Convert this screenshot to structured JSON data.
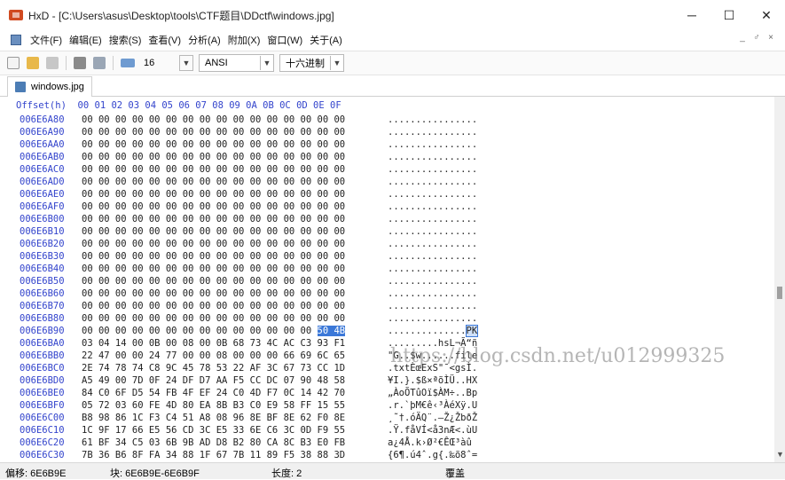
{
  "window": {
    "title": "HxD - [C:\\Users\\asus\\Desktop\\tools\\CTF题目\\DDctf\\windows.jpg]",
    "minimize": "─",
    "maximize": "☐",
    "close": "✕"
  },
  "menu": {
    "items": [
      "文件(F)",
      "编辑(E)",
      "搜索(S)",
      "查看(V)",
      "分析(A)",
      "附加(X)",
      "窗口(W)",
      "关于(A)"
    ],
    "mdi": [
      "_",
      "♂",
      "×"
    ]
  },
  "toolbar": {
    "bytes_per_row": "16",
    "charset": "ANSI",
    "offset_base": "十六进制"
  },
  "tab": {
    "label": "windows.jpg"
  },
  "editor": {
    "header": "Offset(h)  00 01 02 03 04 05 06 07 08 09 0A 0B 0C 0D 0E 0F",
    "rows": [
      {
        "offset": "006E6A80",
        "hex": "00 00 00 00 00 00 00 00 00 00 00 00 00 00 00 00",
        "ascii": "................"
      },
      {
        "offset": "006E6A90",
        "hex": "00 00 00 00 00 00 00 00 00 00 00 00 00 00 00 00",
        "ascii": "................"
      },
      {
        "offset": "006E6AA0",
        "hex": "00 00 00 00 00 00 00 00 00 00 00 00 00 00 00 00",
        "ascii": "................"
      },
      {
        "offset": "006E6AB0",
        "hex": "00 00 00 00 00 00 00 00 00 00 00 00 00 00 00 00",
        "ascii": "................"
      },
      {
        "offset": "006E6AC0",
        "hex": "00 00 00 00 00 00 00 00 00 00 00 00 00 00 00 00",
        "ascii": "................"
      },
      {
        "offset": "006E6AD0",
        "hex": "00 00 00 00 00 00 00 00 00 00 00 00 00 00 00 00",
        "ascii": "................"
      },
      {
        "offset": "006E6AE0",
        "hex": "00 00 00 00 00 00 00 00 00 00 00 00 00 00 00 00",
        "ascii": "................"
      },
      {
        "offset": "006E6AF0",
        "hex": "00 00 00 00 00 00 00 00 00 00 00 00 00 00 00 00",
        "ascii": "................"
      },
      {
        "offset": "006E6B00",
        "hex": "00 00 00 00 00 00 00 00 00 00 00 00 00 00 00 00",
        "ascii": "................"
      },
      {
        "offset": "006E6B10",
        "hex": "00 00 00 00 00 00 00 00 00 00 00 00 00 00 00 00",
        "ascii": "................"
      },
      {
        "offset": "006E6B20",
        "hex": "00 00 00 00 00 00 00 00 00 00 00 00 00 00 00 00",
        "ascii": "................"
      },
      {
        "offset": "006E6B30",
        "hex": "00 00 00 00 00 00 00 00 00 00 00 00 00 00 00 00",
        "ascii": "................"
      },
      {
        "offset": "006E6B40",
        "hex": "00 00 00 00 00 00 00 00 00 00 00 00 00 00 00 00",
        "ascii": "................"
      },
      {
        "offset": "006E6B50",
        "hex": "00 00 00 00 00 00 00 00 00 00 00 00 00 00 00 00",
        "ascii": "................"
      },
      {
        "offset": "006E6B60",
        "hex": "00 00 00 00 00 00 00 00 00 00 00 00 00 00 00 00",
        "ascii": "................"
      },
      {
        "offset": "006E6B70",
        "hex": "00 00 00 00 00 00 00 00 00 00 00 00 00 00 00 00",
        "ascii": "................"
      },
      {
        "offset": "006E6B80",
        "hex": "00 00 00 00 00 00 00 00 00 00 00 00 00 00 00 00",
        "ascii": "................"
      },
      {
        "offset": "006E6B90",
        "hex": "00 00 00 00 00 00 00 00 00 00 00 00 00 00",
        "sel_hex": "50 4B",
        "ascii": "..............",
        "sel_ascii": "PK"
      },
      {
        "offset": "006E6BA0",
        "hex": "03 04 14 00 0B 00 08 00 0B 68 73 4C AC C3 93 F1",
        "ascii": ".........hsL¬Ã“ñ"
      },
      {
        "offset": "006E6BB0",
        "hex": "22 47 00 00 24 77 00 00 08 00 00 00 66 69 6C 65",
        "ascii": "\"G..$w......file"
      },
      {
        "offset": "006E6BC0",
        "hex": "2E 74 78 74 C8 9C 45 78 53 22 AF 3C 67 73 CC 1D",
        ".ascii": "",
        "ascii": ".txtÈœExS\"¯<gsÌ."
      },
      {
        "offset": "006E6BD0",
        "hex": "A5 49 00 7D 0F 24 DF D7 AA F5 CC DC 07 90 48 58",
        "ascii": "¥I.}.$ß×ªõÌÜ..HX"
      },
      {
        "offset": "006E6BE0",
        "hex": "84 C0 6F D5 54 FB 4F EF 24 C0 4D F7 0C 14 42 70",
        "ascii": "„ÀoÕTûOï$ÀM÷..Bp"
      },
      {
        "offset": "006E6BF0",
        "hex": "05 72 03 60 FE 4D 80 EA 8B B3 C0 E9 58 FF 15 55",
        "ascii": ".r.`þM€ê‹³ÀéXÿ.U"
      },
      {
        "offset": "006E6C00",
        "hex": "B8 98 86 1C F3 C4 51 A8 08 96 8E BF 8E 62 F0 8E",
        "ascii": "¸˜†.óÄQ¨.–Ž¿ŽbðŽ"
      },
      {
        "offset": "006E6C10",
        "hex": "1C 9F 17 66 E5 56 CD 3C E5 33 6E C6 3C 0D F9 55",
        "ascii": ".Ÿ.fåVÍ<å3nÆ<.ùU"
      },
      {
        "offset": "006E6C20",
        "hex": "61 BF 34 C5 03 6B 9B AD D8 B2 80 CA 8C B3 E0 FB",
        "ascii": "a¿4Å.k›­Ø²€ÊŒ³àû"
      },
      {
        "offset": "006E6C30",
        "hex": "7B 36 B6 8F FA 34 88 1F 67 7B 11 89 F5 38 88 3D",
        "ascii": "{6¶.ú4ˆ.g{.‰õ8ˆ="
      }
    ]
  },
  "watermark": "https://blog.csdn.net/u012999325",
  "status": {
    "offset": "偏移: 6E6B9E",
    "block": "块: 6E6B9E-6E6B9F",
    "length": "长度: 2",
    "mode": "覆盖"
  }
}
